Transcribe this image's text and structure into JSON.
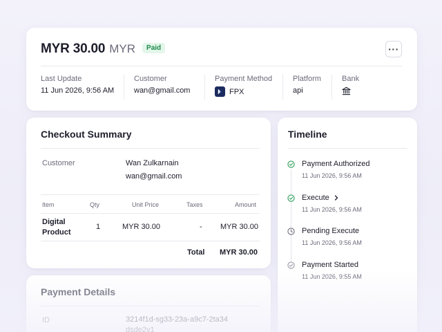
{
  "header": {
    "amount": "MYR 30.00",
    "currency": "MYR",
    "status_badge": "Paid",
    "more_label": "···",
    "meta": {
      "last_update_label": "Last Update",
      "last_update_value": "11 Jun 2026, 9:56 AM",
      "customer_label": "Customer",
      "customer_value": "wan@gmail.com",
      "payment_method_label": "Payment Method",
      "payment_method_value": "FPX",
      "platform_label": "Platform",
      "platform_value": "api",
      "bank_label": "Bank",
      "bank_icon": "bank-icon"
    }
  },
  "checkout_summary": {
    "title": "Checkout Summary",
    "customer_label": "Customer",
    "customer_name": "Wan Zulkarnain",
    "customer_email": "wan@gmail.com",
    "table": {
      "headers": [
        "Item",
        "Qty",
        "Unit Price",
        "Taxes",
        "Amount"
      ],
      "rows": [
        {
          "item_line1": "Digital",
          "item_line2": "Product",
          "qty": "1",
          "unit_price": "MYR 30.00",
          "taxes": "-",
          "amount": "MYR 30.00"
        }
      ],
      "total_label": "Total",
      "total_value": "MYR 30.00"
    }
  },
  "timeline": {
    "title": "Timeline",
    "events": [
      {
        "title": "Payment Authorized",
        "time": "11 Jun 2026, 9:56 AM",
        "icon": "check-circle-icon",
        "color": "#2e9e5b"
      },
      {
        "title": "Execute",
        "time": "11 Jun 2026, 9:56 AM",
        "icon": "check-circle-icon",
        "color": "#2e9e5b",
        "has_chevron": true
      },
      {
        "title": "Pending Execute",
        "time": "11 Jun 2026, 9:56 AM",
        "icon": "clock-icon",
        "color": "#6b6b7b"
      },
      {
        "title": "Payment Started",
        "time": "11 Jun 2026, 9:55 AM",
        "icon": "check-circle-icon",
        "color": "#9b9bab"
      }
    ]
  },
  "payment_details": {
    "title": "Payment Details",
    "id_label": "ID",
    "id_value": "3214f1d-sg33-23a-a9c7-2ta34dsde2v1"
  },
  "colors": {
    "accent_green": "#2e9e5b",
    "badge_bg": "#e3f6ea",
    "fpx_bg": "#1c2b5e",
    "background": "#f1f0fa"
  }
}
